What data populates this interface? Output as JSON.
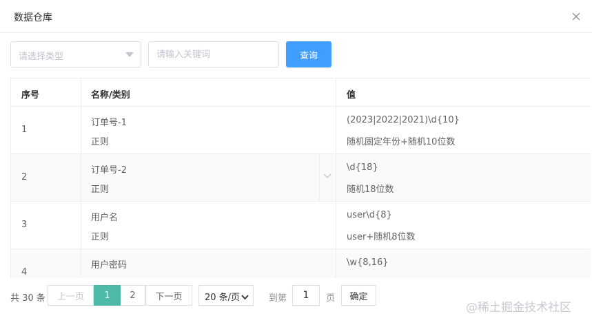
{
  "dialog": {
    "title": "数据仓库"
  },
  "filters": {
    "type_placeholder": "请选择类型",
    "keyword_placeholder": "请输入关键词",
    "query_label": "查询"
  },
  "table": {
    "headers": {
      "index": "序号",
      "name": "名称/类别",
      "value": "值"
    },
    "rows": [
      {
        "index": "1",
        "name": "订单号-1",
        "category": "正则",
        "value": "(2023|2022|2021)\\d{10}",
        "desc": "随机固定年份+随机10位数"
      },
      {
        "index": "2",
        "name": "订单号-2",
        "category": "正则",
        "value": "\\d{18}",
        "desc": "随机18位数"
      },
      {
        "index": "3",
        "name": "用户名",
        "category": "正则",
        "value": "user\\d{8}",
        "desc": "user+随机8位数"
      },
      {
        "index": "4",
        "name": "用户密码",
        "category": "",
        "value": "\\w{8,16}",
        "desc": ""
      }
    ]
  },
  "pagination": {
    "total": "共 30 条",
    "prev": "上一页",
    "pages": [
      "1",
      "2"
    ],
    "current_page": "1",
    "next": "下一页",
    "page_size": "20 条/页",
    "goto_label": "到第",
    "goto_value": "1",
    "page_unit": "页",
    "confirm": "确定"
  },
  "watermark": "@稀土掘金技术社区",
  "icons": {
    "close": "close-icon",
    "select_caret": "caret-down-icon",
    "row_expand": "chevron-down-icon",
    "page_size_dropdown": "chevron-down-icon"
  },
  "colors": {
    "primary": "#409eff",
    "active_page": "#4fb9a8",
    "border": "#ebeef5",
    "placeholder": "#c0c4cc"
  }
}
